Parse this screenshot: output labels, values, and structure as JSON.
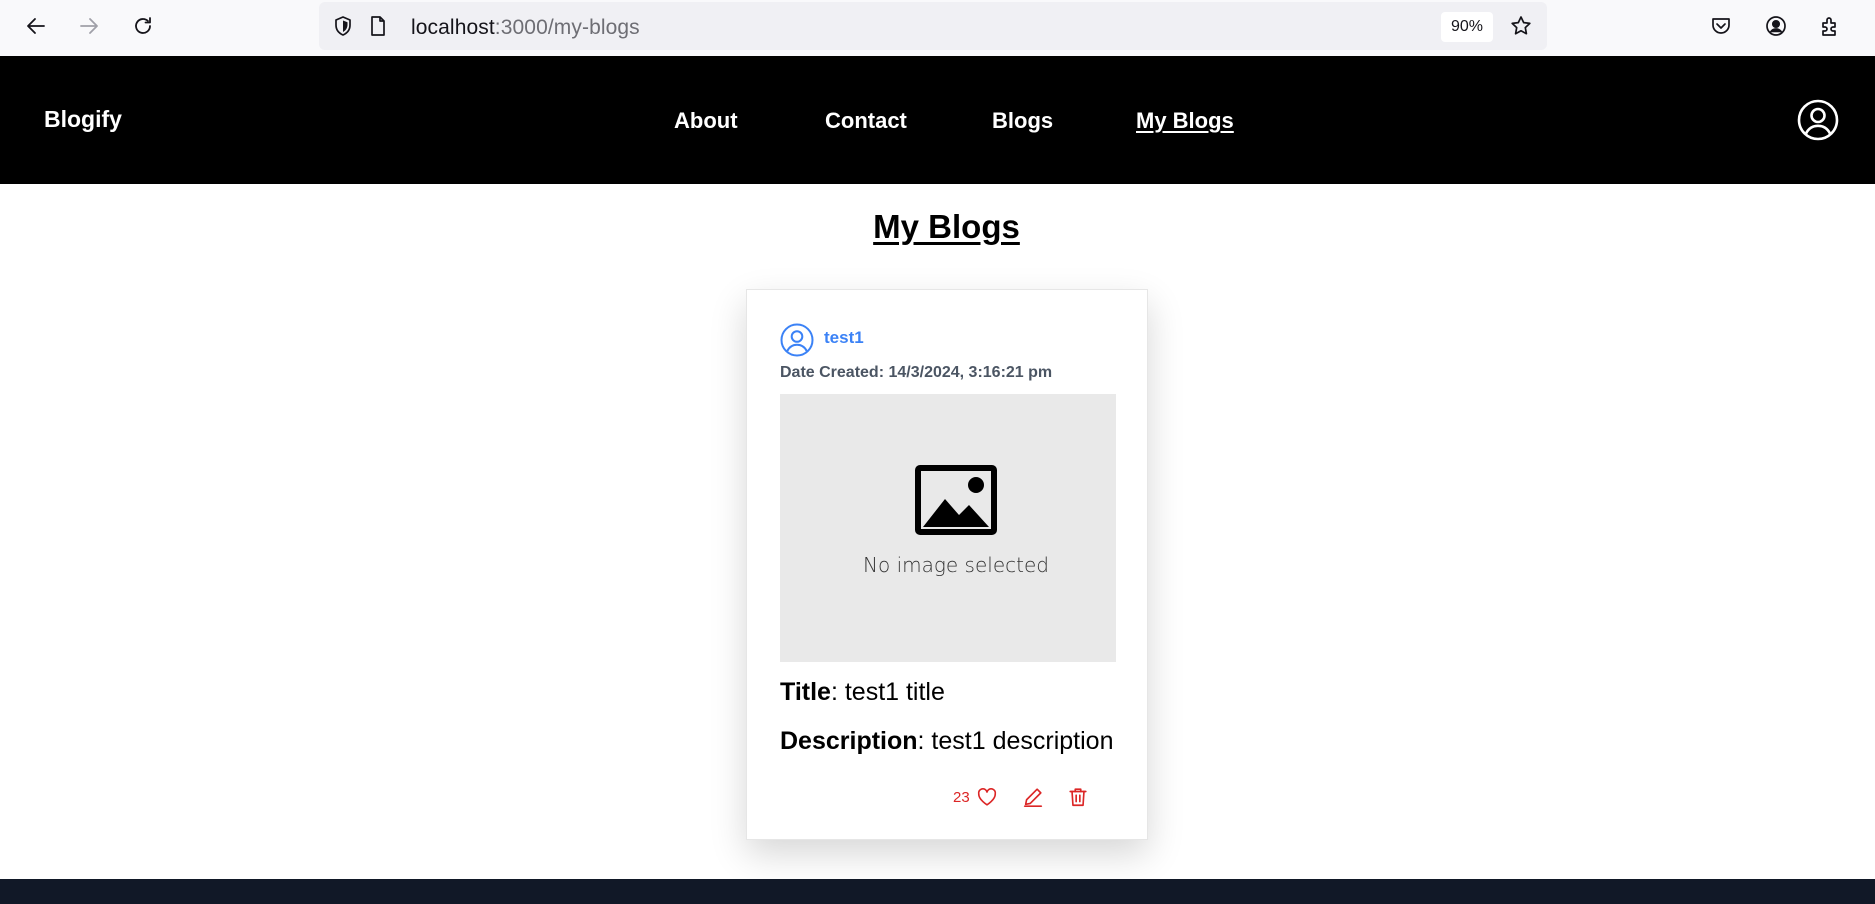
{
  "browser": {
    "url_host": "localhost",
    "url_path": ":3000/my-blogs",
    "zoom": "90%"
  },
  "header": {
    "brand": "Blogify",
    "nav": [
      {
        "label": "About"
      },
      {
        "label": "Contact"
      },
      {
        "label": "Blogs"
      },
      {
        "label": "My Blogs",
        "active": true
      }
    ]
  },
  "page": {
    "title": "My Blogs"
  },
  "blogs": [
    {
      "author": "test1",
      "date_label": "Date Created:",
      "date_value": "14/3/2024, 3:16:21 pm",
      "image_placeholder": "No image selected",
      "title_label": "Title",
      "title_value": ": test1 title",
      "description_label": "Description",
      "description_value": ": test1 description",
      "likes": "23"
    }
  ],
  "colors": {
    "header_bg": "#000000",
    "author": "#3b82f6",
    "action": "#dc2626",
    "footer": "#111827"
  },
  "icons": [
    "back-icon",
    "forward-icon",
    "reload-icon",
    "shield-icon",
    "page-icon",
    "star-icon",
    "pocket-icon",
    "account-icon",
    "extensions-icon",
    "user-circle-icon",
    "image-icon",
    "heart-icon",
    "pencil-icon",
    "trash-icon"
  ]
}
